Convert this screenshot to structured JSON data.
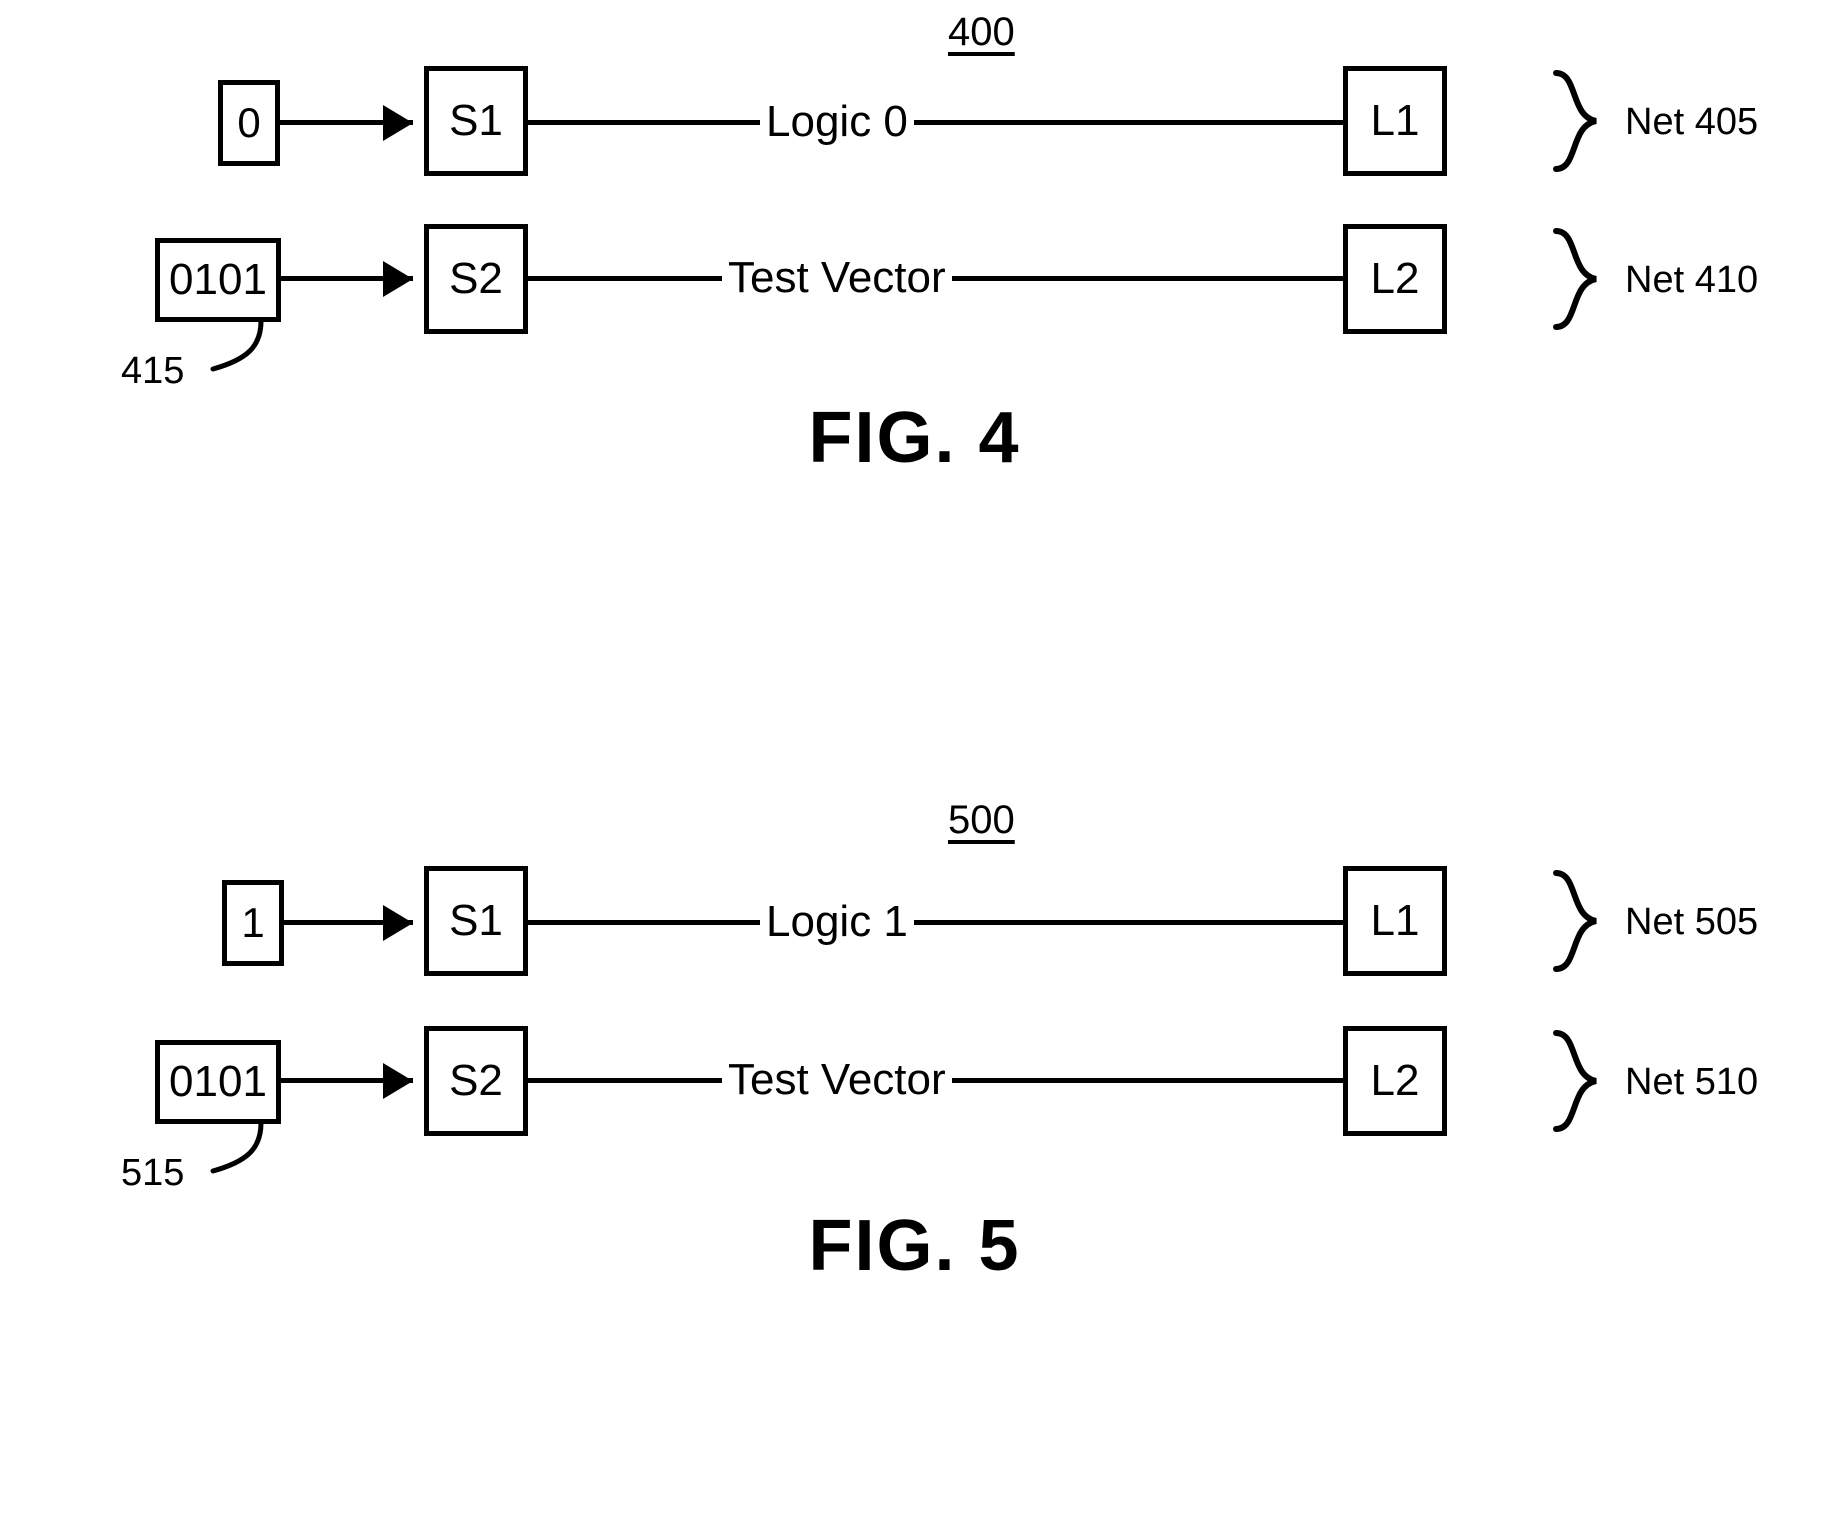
{
  "page": {
    "background_color": "#ffffff",
    "ink_color": "#000000"
  },
  "figures": [
    {
      "id": "fig4",
      "ref_number": "400",
      "caption": "FIG. 4",
      "rows": [
        {
          "source_box": "0",
          "switch_box": "S1",
          "wire_label": "Logic 0",
          "load_box": "L1",
          "net_label": "Net 405"
        },
        {
          "source_box": "0101",
          "switch_box": "S2",
          "wire_label": "Test Vector",
          "load_box": "L2",
          "net_label": "Net 410"
        }
      ],
      "callout": "415"
    },
    {
      "id": "fig5",
      "ref_number": "500",
      "caption": "FIG. 5",
      "rows": [
        {
          "source_box": "1",
          "switch_box": "S1",
          "wire_label": "Logic 1",
          "load_box": "L1",
          "net_label": "Net 505"
        },
        {
          "source_box": "0101",
          "switch_box": "S2",
          "wire_label": "Test Vector",
          "load_box": "L2",
          "net_label": "Net 510"
        }
      ],
      "callout": "515"
    }
  ]
}
